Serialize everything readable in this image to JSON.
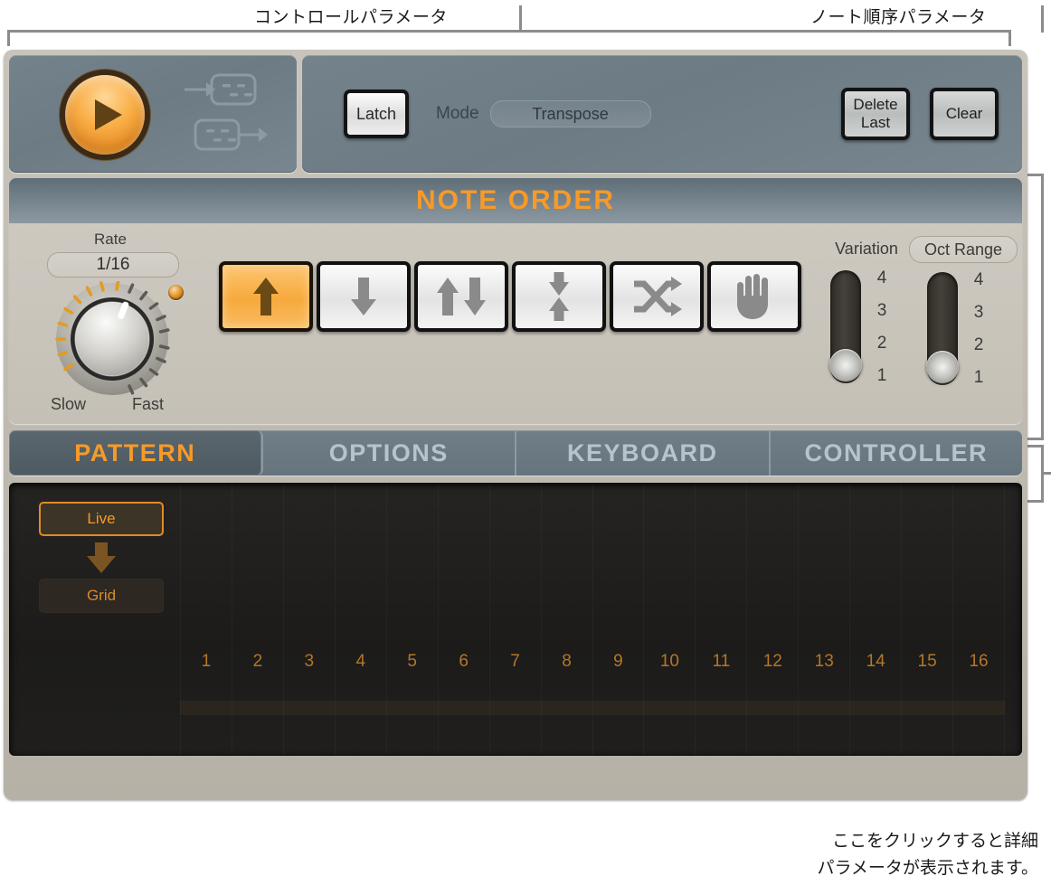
{
  "annotations": {
    "control_params_label": "コントロールパラメータ",
    "note_order_params_label": "ノート順序パラメータ",
    "caption_line1": "ここをクリックすると詳細",
    "caption_line2": "パラメータが表示されます。"
  },
  "transport": {
    "play_icon": "play-icon",
    "midi_in_icon": "midi-in-icon",
    "midi_out_icon": "midi-out-icon"
  },
  "controls": {
    "latch_label": "Latch",
    "mode_label": "Mode",
    "mode_value": "Transpose",
    "delete_last_line1": "Delete",
    "delete_last_line2": "Last",
    "clear_label": "Clear"
  },
  "note_order": {
    "header": "NOTE ORDER",
    "rate_label": "Rate",
    "rate_value": "1/16",
    "knob_min_label": "Slow",
    "knob_max_label": "Fast",
    "buttons": [
      {
        "name": "up",
        "icon": "arrow-up-icon",
        "active": true
      },
      {
        "name": "down",
        "icon": "arrow-down-icon",
        "active": false
      },
      {
        "name": "up-down",
        "icon": "arrow-up-down-icon",
        "active": false
      },
      {
        "name": "outside-in",
        "icon": "arrows-converge-icon",
        "active": false
      },
      {
        "name": "random",
        "icon": "shuffle-icon",
        "active": false
      },
      {
        "name": "as-played",
        "icon": "hand-icon",
        "active": false
      }
    ],
    "variation": {
      "label": "Variation",
      "ticks": [
        "4",
        "3",
        "2",
        "1"
      ],
      "value": "1"
    },
    "oct_range": {
      "label": "Oct Range",
      "ticks": [
        "4",
        "3",
        "2",
        "1"
      ],
      "value": "1"
    }
  },
  "tabs": [
    {
      "label": "PATTERN",
      "active": true
    },
    {
      "label": "OPTIONS",
      "active": false
    },
    {
      "label": "KEYBOARD",
      "active": false
    },
    {
      "label": "CONTROLLER",
      "active": false
    }
  ],
  "pattern": {
    "live_label": "Live",
    "grid_label": "Grid",
    "arrow_icon": "arrow-down-icon",
    "steps": [
      "1",
      "2",
      "3",
      "4",
      "5",
      "6",
      "7",
      "8",
      "9",
      "10",
      "11",
      "12",
      "13",
      "14",
      "15",
      "16"
    ]
  },
  "colors": {
    "accent_orange": "#f79a28",
    "slate": "#6d7b85",
    "chassis": "#c8c4bb",
    "display_bg": "#1c1b19"
  }
}
